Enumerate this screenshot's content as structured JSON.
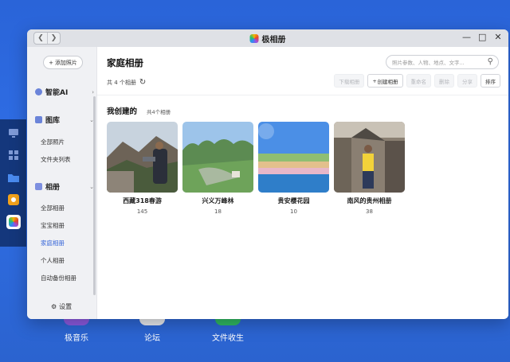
{
  "window": {
    "title": "极相册"
  },
  "sidebar": {
    "add_button": "添加照片",
    "sections": [
      {
        "label": "智能AI"
      },
      {
        "label": "图库",
        "items": [
          "全部照片",
          "文件夹列表"
        ]
      },
      {
        "label": "相册",
        "items": [
          "全部相册",
          "宝宝相册",
          "家庭相册",
          "个人相册",
          "自动备份相册"
        ]
      }
    ],
    "settings": "设置"
  },
  "main": {
    "title": "家庭相册",
    "search_placeholder": "照片参数、人物、地点、文字...",
    "album_count": "共 4 个相册",
    "toolbar": [
      "下载相册",
      "创建相册",
      "重命名",
      "删除",
      "分享",
      "排序"
    ],
    "section_title": "我创建的",
    "section_count": "共4个相册",
    "albums": [
      {
        "name": "西藏318春游",
        "count": "145"
      },
      {
        "name": "兴义万峰林",
        "count": "18"
      },
      {
        "name": "贵安樱花园",
        "count": "10"
      },
      {
        "name": "南风的贵州相册",
        "count": "38"
      }
    ]
  },
  "desktop": {
    "apps": [
      "极音乐",
      "论坛",
      "文件收生"
    ]
  },
  "colors": {
    "accent": "#3565d8",
    "desktop": "#2f6ee6",
    "dock": "#14377c"
  }
}
